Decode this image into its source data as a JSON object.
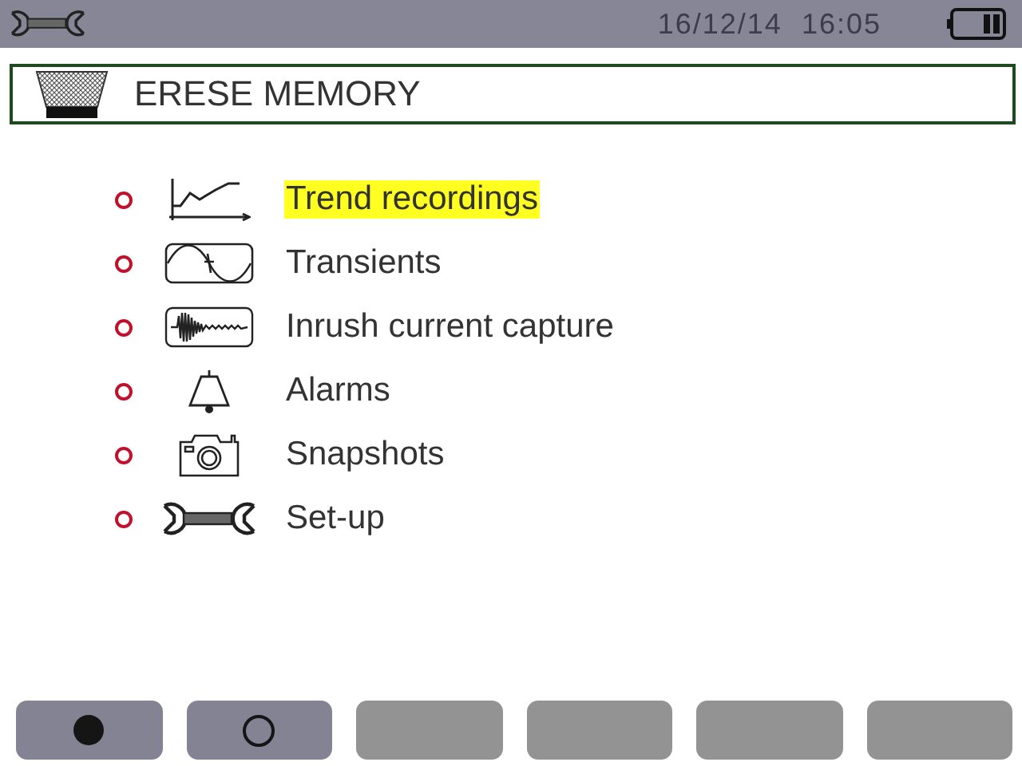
{
  "status_bar": {
    "date": "16/12/14",
    "time": "16:05"
  },
  "title": "ERESE MEMORY",
  "menu": [
    {
      "kind": "trend",
      "label": "Trend recordings",
      "selected": true
    },
    {
      "kind": "transient",
      "label": "Transients",
      "selected": false
    },
    {
      "kind": "inrush",
      "label": "Inrush current capture",
      "selected": false
    },
    {
      "kind": "alarm",
      "label": "Alarms",
      "selected": false
    },
    {
      "kind": "snapshot",
      "label": "Snapshots",
      "selected": false
    },
    {
      "kind": "setup",
      "label": "Set-up",
      "selected": false
    }
  ],
  "softkeys": [
    {
      "kind": "filled-dot",
      "disabled": false
    },
    {
      "kind": "ring",
      "disabled": false
    },
    {
      "kind": "blank",
      "disabled": true
    },
    {
      "kind": "blank",
      "disabled": true
    },
    {
      "kind": "blank",
      "disabled": true
    },
    {
      "kind": "blank",
      "disabled": true
    }
  ]
}
